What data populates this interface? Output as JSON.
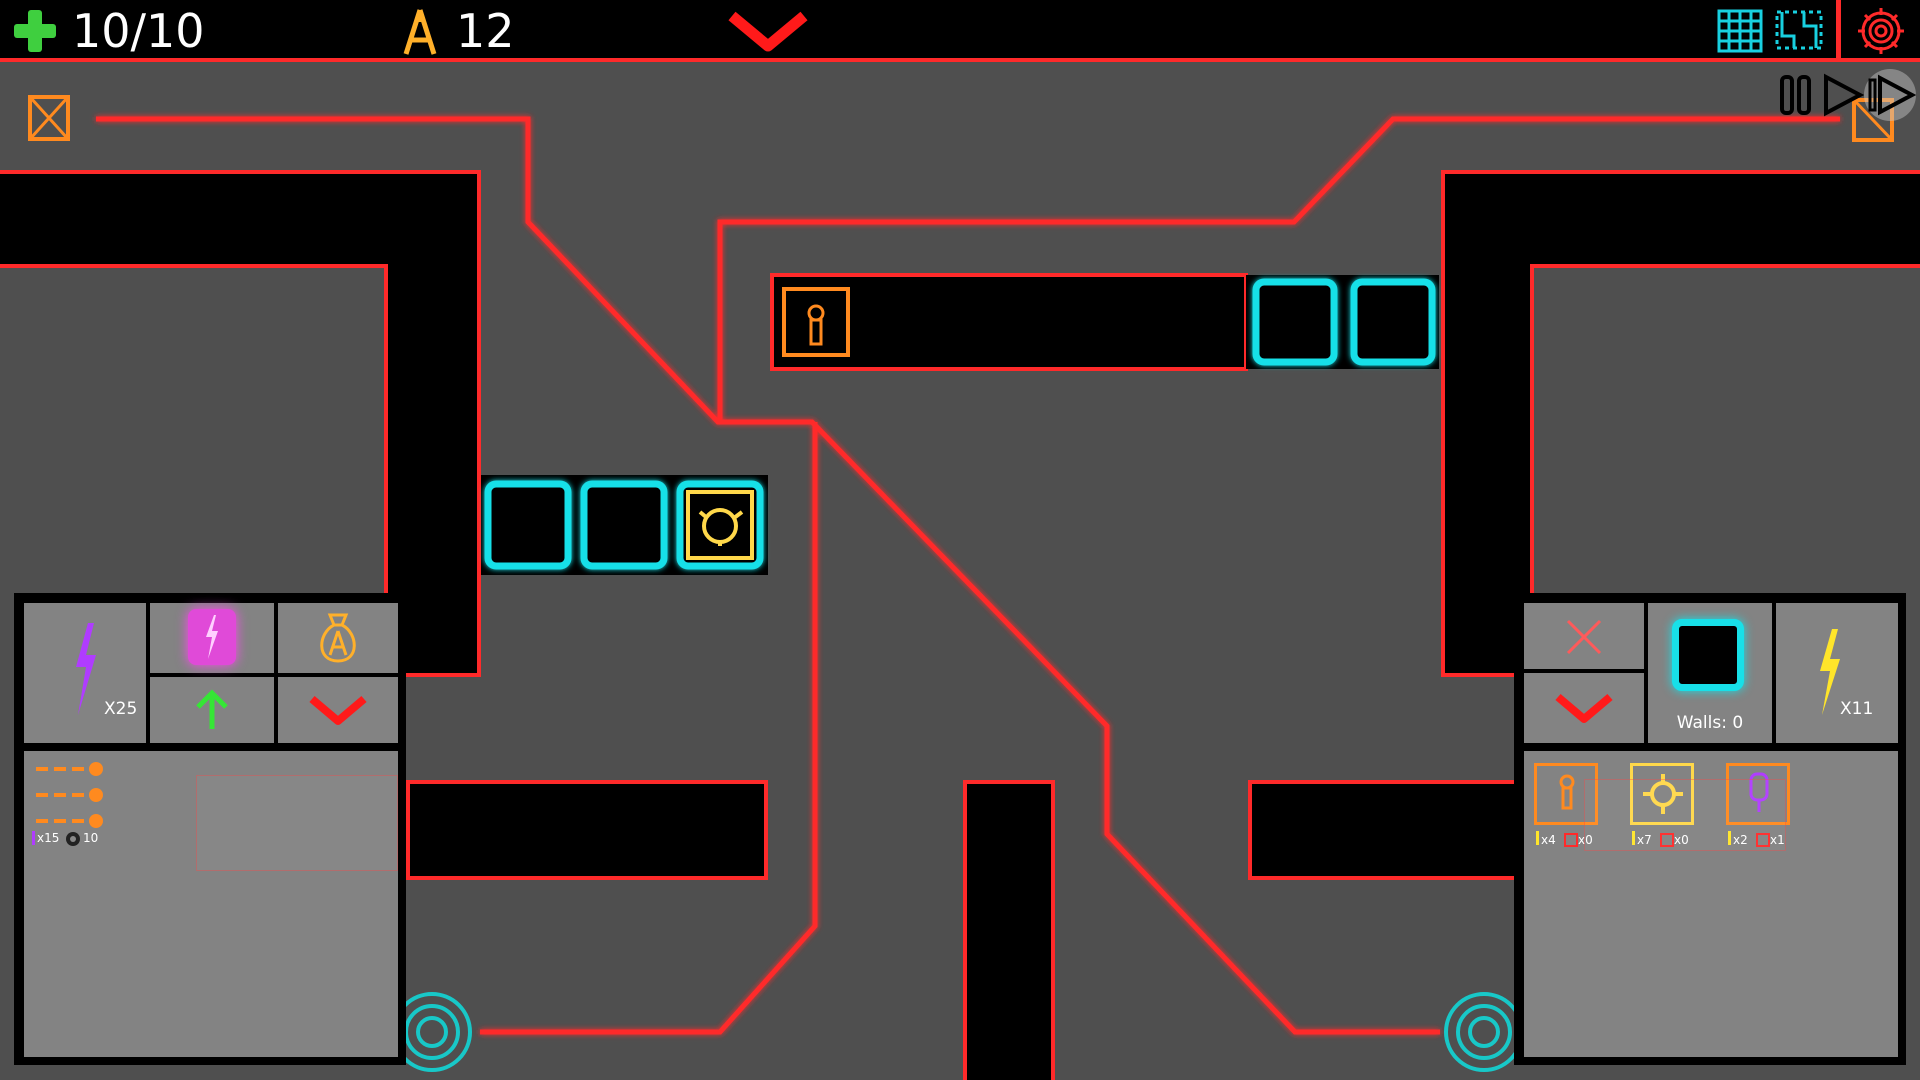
{
  "hud": {
    "health": "10/10",
    "currency": "12",
    "icons": [
      "plus-icon",
      "currency-tower-icon",
      "chevron-down-icon",
      "grid-icon",
      "path-icon",
      "settings-gear-icon"
    ]
  },
  "playback": {
    "icons": [
      "pause-icon",
      "play-icon",
      "fast-forward-icon"
    ]
  },
  "left_panel": {
    "energy_label": "X25",
    "stats": {
      "energy": "x15",
      "gear": "10"
    }
  },
  "right_panel": {
    "walls_label": "Walls: 0",
    "energy_label": "X11",
    "towers": [
      {
        "icon": "thermometer-tower-icon",
        "color": "#ff8a1f",
        "energy": "x4",
        "count": "x0"
      },
      {
        "icon": "target-tower-icon",
        "color": "#ffd84a",
        "energy": "x7",
        "count": "x0"
      },
      {
        "icon": "capsule-tower-icon",
        "color": "#ff8a1f",
        "energy": "x2",
        "count": "x1"
      }
    ]
  },
  "colors": {
    "background": "#4f4f4f",
    "wall": "#000000",
    "laser": "#ff2a2a",
    "neon_cyan": "#18e0e8",
    "neon_orange": "#ff8a1f",
    "neon_yellow": "#ffd84a",
    "neon_purple": "#b03cff",
    "neon_green": "#35e635"
  }
}
